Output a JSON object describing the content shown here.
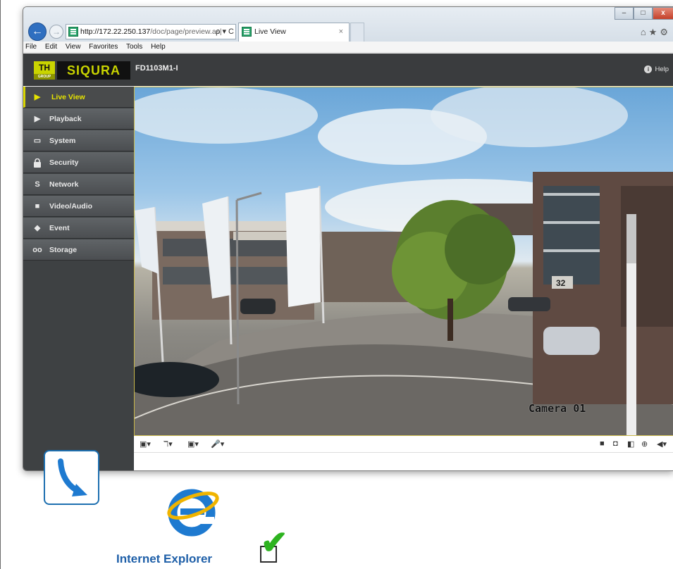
{
  "browser": {
    "address_host": "http://172.22.250.137",
    "address_path": "/doc/page/preview.as|",
    "address_tools": "ρ ▾ C",
    "tab_title": "Live View",
    "tab_close": "×",
    "back_glyph": "←",
    "forward_glyph": "→",
    "window_controls": {
      "minimize": "–",
      "maximize": "□",
      "close": "x"
    },
    "ie_icons": "⌂★⚙"
  },
  "menubar": [
    "File",
    "Edit",
    "View",
    "Favorites",
    "Tools",
    "Help"
  ],
  "header": {
    "logo_th": "TH",
    "logo_group": "GROUP",
    "logo_siqura": "SIQURA",
    "device_name": "FD1103M1-I",
    "help_label": "Help",
    "help_icon": "i"
  },
  "sidebar": {
    "items": [
      {
        "label": "Live View",
        "icon": "play-triangle-icon",
        "glyph": "▶",
        "active": true
      },
      {
        "label": "Playback",
        "icon": "playback-icon",
        "glyph": "▶",
        "active": false
      },
      {
        "label": "System",
        "icon": "system-icon",
        "glyph": "▭",
        "active": false
      },
      {
        "label": "Security",
        "icon": "lock-icon",
        "glyph": "🔒",
        "active": false
      },
      {
        "label": "Network",
        "icon": "network-icon",
        "glyph": "S",
        "active": false
      },
      {
        "label": "Video/Audio",
        "icon": "video-camera-icon",
        "glyph": "■",
        "active": false
      },
      {
        "label": "Event",
        "icon": "event-icon",
        "glyph": "◆",
        "active": false
      },
      {
        "label": "Storage",
        "icon": "storage-icon",
        "glyph": "oo",
        "active": false
      }
    ]
  },
  "video": {
    "camera_label": "Camera 01",
    "building_number": "32"
  },
  "toolbar": {
    "left": [
      "▣▾",
      "ℸ▾",
      "▣▾",
      "🎤▾"
    ],
    "right": [
      "■",
      "◘",
      "◧",
      "⊕",
      "◀▾"
    ]
  },
  "overlay": {
    "ie_label": "Internet Explorer",
    "check_glyph": "✔"
  },
  "colors": {
    "accent_yellow": "#d8d400",
    "logo_green": "#c9d400",
    "sidebar_bg": "#3e4143",
    "ie_blue": "#1e7ad0",
    "check_green": "#2db31f"
  }
}
